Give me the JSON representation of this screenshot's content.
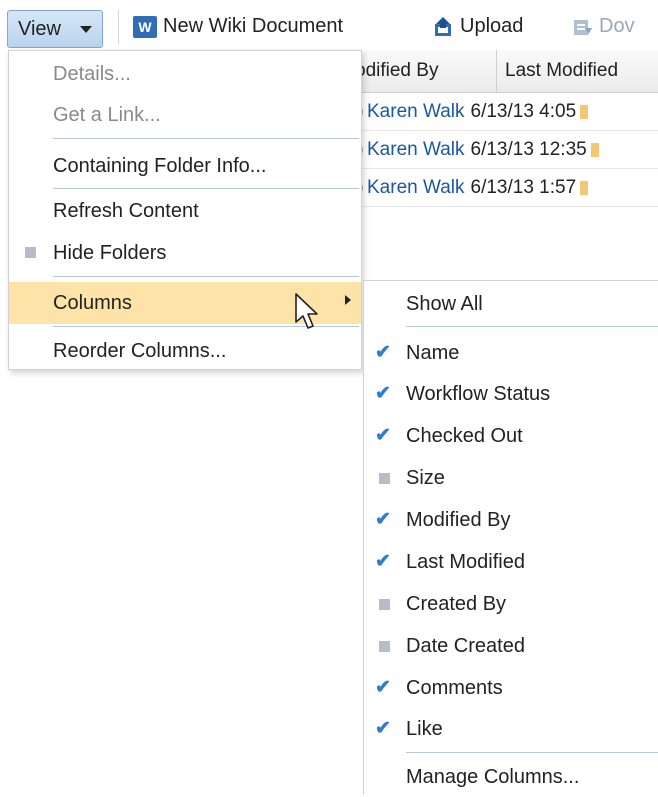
{
  "toolbar": {
    "view_label": "View",
    "new_wiki_label": "New Wiki Document",
    "wiki_icon_text": "W",
    "upload_label": "Upload",
    "download_label": "Dov"
  },
  "table": {
    "headers": {
      "modified_by": "odified By",
      "last_modified": "Last Modified"
    },
    "rows": [
      {
        "user": "Karen Walk",
        "date": "6/13/13 4:05"
      },
      {
        "user": "Karen Walk",
        "date": "6/13/13 12:35"
      },
      {
        "user": "Karen Walk",
        "date": "6/13/13 1:57"
      }
    ]
  },
  "view_menu": {
    "items": [
      {
        "label": "Details...",
        "enabled": false
      },
      {
        "label": "Get a Link...",
        "enabled": false
      },
      {
        "label": "Containing Folder Info...",
        "enabled": true
      },
      {
        "label": "Refresh Content",
        "enabled": true
      },
      {
        "label": "Hide Folders",
        "enabled": true,
        "indicator": "unchecked-square"
      },
      {
        "label": "Columns",
        "enabled": true,
        "highlighted": true,
        "has_submenu": true
      },
      {
        "label": "Reorder Columns...",
        "enabled": true
      }
    ]
  },
  "columns_submenu": {
    "show_all": "Show All",
    "items": [
      {
        "label": "Name",
        "checked": true
      },
      {
        "label": "Workflow Status",
        "checked": true
      },
      {
        "label": "Checked Out",
        "checked": true
      },
      {
        "label": "Size",
        "checked": false
      },
      {
        "label": "Modified By",
        "checked": true
      },
      {
        "label": "Last Modified",
        "checked": true
      },
      {
        "label": "Created By",
        "checked": false
      },
      {
        "label": "Date Created",
        "checked": false
      },
      {
        "label": "Comments",
        "checked": true
      },
      {
        "label": "Like",
        "checked": true
      }
    ],
    "manage": "Manage Columns...",
    "check_glyph": "✔"
  },
  "colors": {
    "accent": "#2f7fd1",
    "highlight": "#fde3a7",
    "link": "#1a57a6"
  }
}
